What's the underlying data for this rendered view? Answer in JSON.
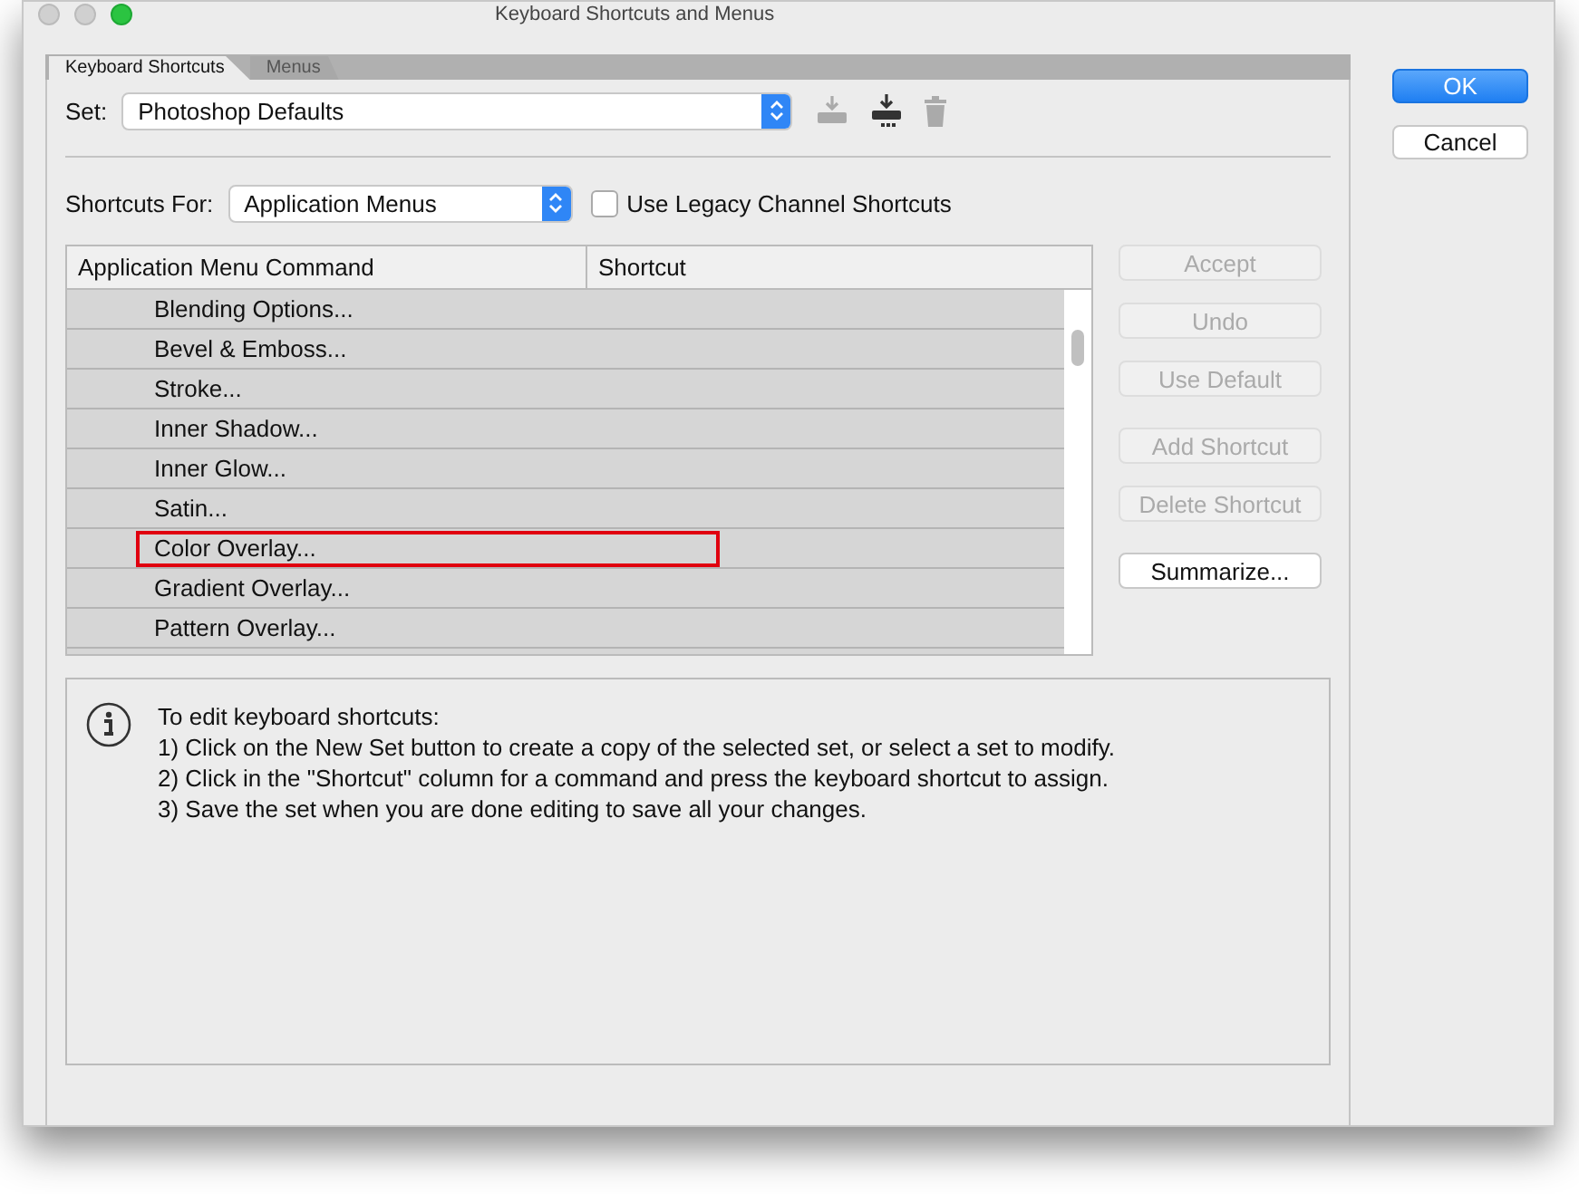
{
  "window": {
    "title": "Keyboard Shortcuts and Menus"
  },
  "tabs": [
    {
      "label": "Keyboard Shortcuts",
      "selected": true
    },
    {
      "label": "Menus",
      "selected": false
    }
  ],
  "set": {
    "label": "Set:",
    "value": "Photoshop Defaults"
  },
  "set_icons": [
    {
      "kind": "save",
      "disabled": true
    },
    {
      "kind": "new",
      "disabled": false
    },
    {
      "kind": "delete",
      "disabled": true
    }
  ],
  "shortcuts_for": {
    "label": "Shortcuts For:",
    "value": "Application Menus"
  },
  "legacy_checkbox": {
    "label": "Use Legacy Channel Shortcuts",
    "checked": false
  },
  "table": {
    "columns": [
      "Application Menu Command",
      "Shortcut"
    ],
    "rows": [
      {
        "command": "Blending Options...",
        "highlighted": false
      },
      {
        "command": "Bevel & Emboss...",
        "highlighted": false
      },
      {
        "command": "Stroke...",
        "highlighted": false
      },
      {
        "command": "Inner Shadow...",
        "highlighted": false
      },
      {
        "command": "Inner Glow...",
        "highlighted": false
      },
      {
        "command": "Satin...",
        "highlighted": false
      },
      {
        "command": "Color Overlay...",
        "highlighted": true
      },
      {
        "command": "Gradient Overlay...",
        "highlighted": false
      },
      {
        "command": "Pattern Overlay...",
        "highlighted": false
      }
    ]
  },
  "side_buttons": [
    {
      "label": "Accept",
      "disabled": true
    },
    {
      "label": "Undo",
      "disabled": true
    },
    {
      "label": "Use Default",
      "disabled": true
    },
    {
      "label": "Add Shortcut",
      "disabled": true
    },
    {
      "label": "Delete Shortcut",
      "disabled": true
    },
    {
      "label": "Summarize...",
      "disabled": false
    }
  ],
  "info": {
    "heading": "To edit keyboard shortcuts:",
    "lines": [
      "1) Click on the New Set button to create a copy of the selected set, or select a set to modify.",
      "2) Click in the \"Shortcut\" column for a command and press the keyboard shortcut to assign.",
      "3) Save the set when you are done editing to save all your changes."
    ]
  },
  "dialog_buttons": [
    {
      "label": "OK",
      "kind": "default"
    },
    {
      "label": "Cancel",
      "kind": "normal"
    }
  ]
}
